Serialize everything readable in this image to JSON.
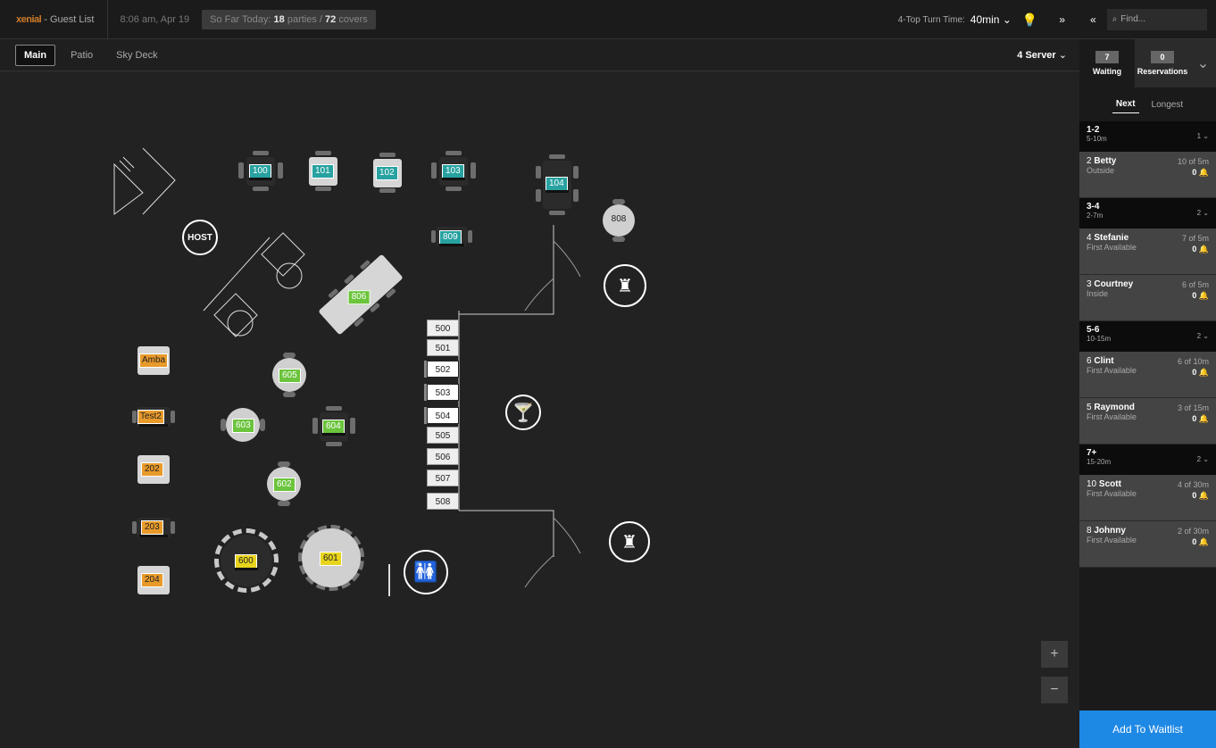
{
  "header": {
    "logo": "xenial",
    "title": "- Guest List",
    "time": "8:06 am, Apr 19",
    "today_prefix": "So Far Today:",
    "parties": "18",
    "parties_label": "parties /",
    "covers": "72",
    "covers_label": "covers",
    "turn_time_label": "4-Top Turn Time:",
    "turn_time_value": "40min",
    "collapse_glyph": "«",
    "expand_glyph": "»",
    "find_placeholder": "Find..."
  },
  "tabs": [
    "Main",
    "Patio",
    "Sky Deck"
  ],
  "server_filter": "4 Server",
  "floor": {
    "host_label": "HOST",
    "tables": {
      "t100": "100",
      "t101": "101",
      "t102": "102",
      "t103": "103",
      "t104": "104",
      "t808": "808",
      "t809": "809",
      "t806": "806",
      "t605": "605",
      "t603": "603",
      "t604": "604",
      "t602": "602",
      "t600": "600",
      "t601": "601",
      "amba": "Amba",
      "test2": "Test2",
      "t202": "202",
      "t203": "203",
      "t204": "204"
    },
    "bar_seats": [
      "500",
      "501",
      "502",
      "503",
      "504",
      "505",
      "506",
      "507",
      "508"
    ],
    "zoom_in": "+",
    "zoom_out": "−"
  },
  "sidebar": {
    "waiting_count": "7",
    "waiting_label": "Waiting",
    "reservations_count": "0",
    "reservations_label": "Reservations",
    "sort_next": "Next",
    "sort_longest": "Longest",
    "groups": [
      {
        "size": "1-2",
        "range": "5-10m",
        "count": "1",
        "entries": [
          {
            "size": "2",
            "name": "Betty",
            "area": "Outside",
            "wait": "10 of 5m",
            "bell": "0"
          }
        ]
      },
      {
        "size": "3-4",
        "range": "2-7m",
        "count": "2",
        "entries": [
          {
            "size": "4",
            "name": "Stefanie",
            "area": "First Available",
            "wait": "7 of 5m",
            "bell": "0"
          },
          {
            "size": "3",
            "name": "Courtney",
            "area": "Inside",
            "wait": "6 of 5m",
            "bell": "0"
          }
        ]
      },
      {
        "size": "5-6",
        "range": "10-15m",
        "count": "2",
        "entries": [
          {
            "size": "6",
            "name": "Clint",
            "area": "First Available",
            "wait": "6 of 10m",
            "bell": "0"
          },
          {
            "size": "5",
            "name": "Raymond",
            "area": "First Available",
            "wait": "3 of 15m",
            "bell": "0"
          }
        ]
      },
      {
        "size": "7+",
        "range": "15-20m",
        "count": "2",
        "entries": [
          {
            "size": "10",
            "name": "Scott",
            "area": "First Available",
            "wait": "4 of 30m",
            "bell": "0"
          },
          {
            "size": "8",
            "name": "Johnny",
            "area": "First Available",
            "wait": "2 of 30m",
            "bell": "0"
          }
        ]
      }
    ],
    "add_button": "Add To Waitlist"
  }
}
